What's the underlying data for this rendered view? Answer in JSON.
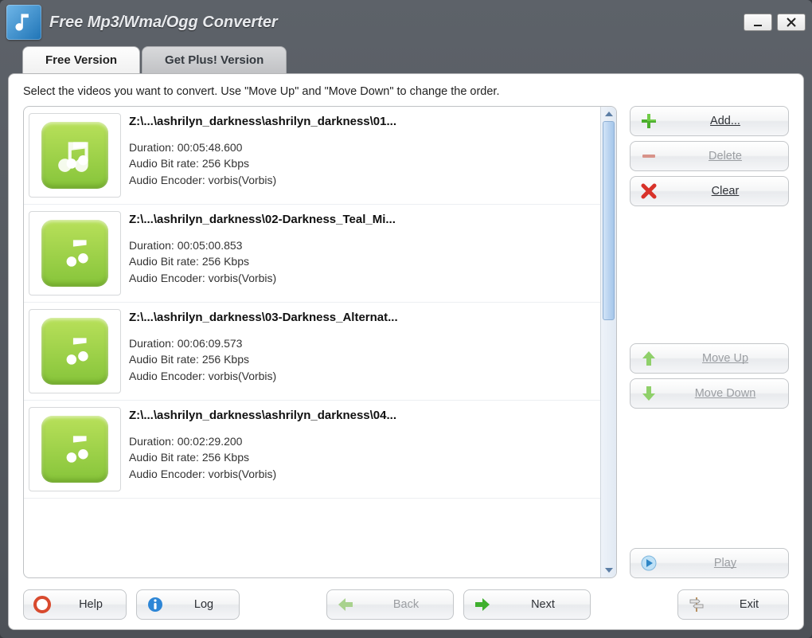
{
  "app": {
    "title": "Free Mp3/Wma/Ogg Converter"
  },
  "tabs": {
    "free": "Free Version",
    "plus": "Get Plus! Version"
  },
  "instruction": "Select the videos you want to convert. Use \"Move Up\" and \"Move Down\" to change the order.",
  "labels": {
    "duration": "Duration:",
    "bitrate": "Audio Bit rate:",
    "encoder": "Audio Encoder:"
  },
  "items": [
    {
      "path": "Z:\\...\\ashrilyn_darkness\\ashrilyn_darkness\\01...",
      "duration": "00:05:48.600",
      "bitrate": "256 Kbps",
      "encoder": "vorbis(Vorbis)"
    },
    {
      "path": "Z:\\...\\ashrilyn_darkness\\02-Darkness_Teal_Mi...",
      "duration": "00:05:00.853",
      "bitrate": "256 Kbps",
      "encoder": "vorbis(Vorbis)"
    },
    {
      "path": "Z:\\...\\ashrilyn_darkness\\03-Darkness_Alternat...",
      "duration": "00:06:09.573",
      "bitrate": "256 Kbps",
      "encoder": "vorbis(Vorbis)"
    },
    {
      "path": "Z:\\...\\ashrilyn_darkness\\ashrilyn_darkness\\04...",
      "duration": "00:02:29.200",
      "bitrate": "256 Kbps",
      "encoder": "vorbis(Vorbis)"
    }
  ],
  "buttons": {
    "add": "Add...",
    "delete": "Delete",
    "clear": "Clear",
    "moveup": "Move Up",
    "movedown": "Move Down",
    "play": "Play",
    "help": "Help",
    "log": "Log",
    "back": "Back",
    "next": "Next",
    "exit": "Exit"
  }
}
